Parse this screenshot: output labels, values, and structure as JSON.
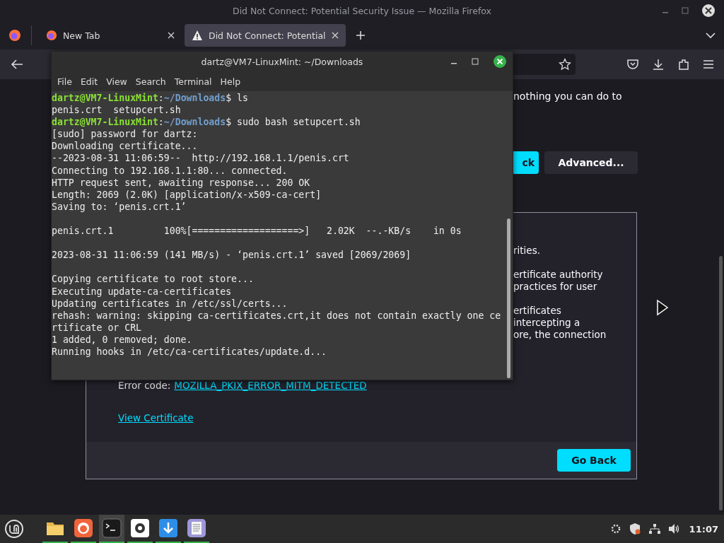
{
  "firefox": {
    "title": "Did Not Connect: Potential Security Issue — Mozilla Firefox",
    "tabs": [
      {
        "label": "New Tab",
        "kind": "firefox",
        "selected": false
      },
      {
        "label": "Did Not Connect: Potential",
        "kind": "warning",
        "selected": true
      }
    ],
    "page": {
      "intro_fragment": "nothing you can do to",
      "buttons": [
        {
          "label": "ck",
          "kind": "primary"
        },
        {
          "label": "Advanced...",
          "kind": "secondary"
        }
      ],
      "paragraphs": [
        [
          "rities."
        ],
        [
          "ertificate authority",
          "practices for user"
        ],
        [
          "ertificates",
          "intercepting a",
          "ore, the connection"
        ]
      ],
      "error_label": "Error code:",
      "error_code": "MOZILLA_PKIX_ERROR_MITM_DETECTED",
      "link": "View Certificate",
      "go_back": "Go Back"
    }
  },
  "terminal": {
    "title": "dartz@VM7-LinuxMint: ~/Downloads",
    "menu": [
      "File",
      "Edit",
      "View",
      "Search",
      "Terminal",
      "Help"
    ],
    "lines": [
      {
        "blank_before": false,
        "segments": [
          {
            "kind": "user",
            "text": "dartz@VM7-LinuxMint"
          },
          {
            "kind": "plain",
            "text": ":"
          },
          {
            "kind": "path",
            "text": "~/Downloads"
          },
          {
            "kind": "plain",
            "text": "$ ls"
          }
        ]
      },
      {
        "blank_before": false,
        "segments": [
          {
            "kind": "plain",
            "text": "penis.crt  setupcert.sh"
          }
        ]
      },
      {
        "blank_before": false,
        "segments": [
          {
            "kind": "user",
            "text": "dartz@VM7-LinuxMint"
          },
          {
            "kind": "plain",
            "text": ":"
          },
          {
            "kind": "path",
            "text": "~/Downloads"
          },
          {
            "kind": "plain",
            "text": "$ sudo bash setupcert.sh"
          }
        ]
      },
      {
        "blank_before": false,
        "segments": [
          {
            "kind": "plain",
            "text": "[sudo] password for dartz:"
          }
        ]
      },
      {
        "blank_before": false,
        "segments": [
          {
            "kind": "plain",
            "text": "Downloading certificate..."
          }
        ]
      },
      {
        "blank_before": false,
        "segments": [
          {
            "kind": "plain",
            "text": "--2023-08-31 11:06:59--  http://192.168.1.1/penis.crt"
          }
        ]
      },
      {
        "blank_before": false,
        "segments": [
          {
            "kind": "plain",
            "text": "Connecting to 192.168.1.1:80... connected."
          }
        ]
      },
      {
        "blank_before": false,
        "segments": [
          {
            "kind": "plain",
            "text": "HTTP request sent, awaiting response... 200 OK"
          }
        ]
      },
      {
        "blank_before": false,
        "segments": [
          {
            "kind": "plain",
            "text": "Length: 2069 (2.0K) [application/x-x509-ca-cert]"
          }
        ]
      },
      {
        "blank_before": false,
        "segments": [
          {
            "kind": "plain",
            "text": "Saving to: ‘penis.crt.1’"
          }
        ]
      },
      {
        "blank_before": true,
        "segments": [
          {
            "kind": "plain",
            "text": "penis.crt.1         100%[===================>]   2.02K  --.-KB/s    in 0s"
          }
        ]
      },
      {
        "blank_before": true,
        "segments": [
          {
            "kind": "plain",
            "text": "2023-08-31 11:06:59 (141 MB/s) - ‘penis.crt.1’ saved [2069/2069]"
          }
        ]
      },
      {
        "blank_before": true,
        "segments": [
          {
            "kind": "plain",
            "text": "Copying certificate to root store..."
          }
        ]
      },
      {
        "blank_before": false,
        "segments": [
          {
            "kind": "plain",
            "text": "Executing update-ca-certificates"
          }
        ]
      },
      {
        "blank_before": false,
        "segments": [
          {
            "kind": "plain",
            "text": "Updating certificates in /etc/ssl/certs..."
          }
        ]
      },
      {
        "blank_before": false,
        "segments": [
          {
            "kind": "plain",
            "text": "rehash: warning: skipping ca-certificates.crt,it does not contain exactly one ce"
          }
        ]
      },
      {
        "blank_before": false,
        "segments": [
          {
            "kind": "plain",
            "text": "rtificate or CRL"
          }
        ]
      },
      {
        "blank_before": false,
        "segments": [
          {
            "kind": "plain",
            "text": "1 added, 0 removed; done."
          }
        ]
      },
      {
        "blank_before": false,
        "segments": [
          {
            "kind": "plain",
            "text": "Running hooks in /etc/ca-certificates/update.d..."
          }
        ]
      }
    ]
  },
  "taskbar": {
    "apps": [
      {
        "kind": "files",
        "running": true,
        "selected": false
      },
      {
        "kind": "firefox",
        "running": true,
        "selected": false
      },
      {
        "kind": "terminal",
        "running": true,
        "selected": true
      },
      {
        "kind": "settings",
        "running": true,
        "selected": false
      },
      {
        "kind": "download",
        "running": true,
        "selected": false
      },
      {
        "kind": "notes",
        "running": true,
        "selected": false
      }
    ],
    "clock": "11:07"
  }
}
